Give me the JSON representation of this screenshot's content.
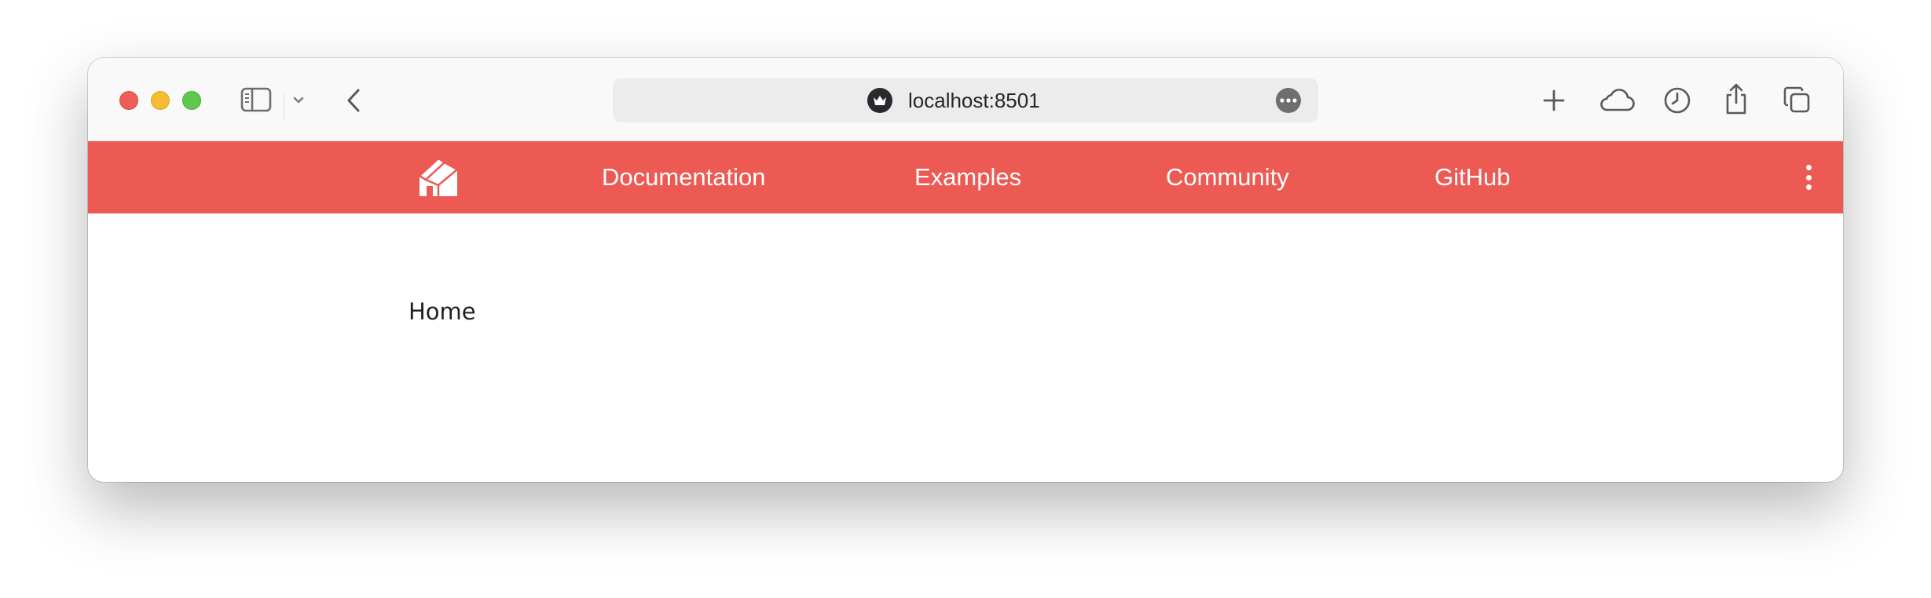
{
  "browser": {
    "url": "localhost:8501",
    "icons": {
      "sidebar": "sidebar-icon",
      "sidebar_menu": "chevron-down-icon",
      "back": "chevron-left-icon",
      "site": "crown-icon",
      "more": "ellipsis-icon",
      "new_tab": "plus-icon",
      "cloud": "cloud-icon",
      "history": "clock-icon",
      "share": "share-icon",
      "tabs": "tabs-overview-icon"
    }
  },
  "app": {
    "accent_color": "#ec5a53",
    "logo_icon": "house-icon",
    "nav": {
      "documentation": "Documentation",
      "examples": "Examples",
      "community": "Community",
      "github": "GitHub"
    },
    "menu_icon": "kebab-menu-icon",
    "page_title": "Home"
  }
}
